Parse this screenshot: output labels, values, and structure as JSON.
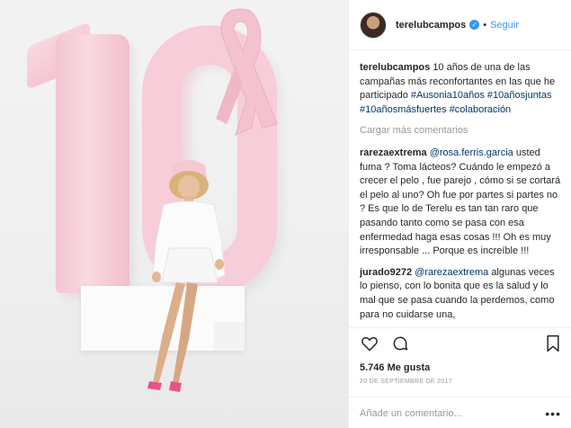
{
  "header": {
    "username": "terelubcampos",
    "verified_icon": "verified-badge-icon",
    "separator": "•",
    "follow_label": "Seguir"
  },
  "caption": {
    "username": "terelubcampos",
    "text": "10 años de una de las campañas más reconfortantes en las que he participado",
    "hashtags": [
      "#Ausonia10años",
      "#10añosjuntas",
      "#10añosmásfuertes",
      "#colaboración"
    ]
  },
  "load_more": "Cargar más comentarios",
  "comments": [
    {
      "username": "rarezaextrema",
      "mention": "@rosa.ferris.garcia",
      "text": "usted fuma ? Toma lácteos? Cuándo le empezó a crecer el pelo , fue parejo , cómo si se cortará el pelo al uno? Oh fue por partes si partes no ? Es que lo de Terelu es tan tan raro que pasando tanto como se pasa con esa enfermedad haga esas cosas !!! Oh es muy irresponsable ... Porque es increíble !!!"
    },
    {
      "username": "jurado9272",
      "mention": "@rarezaextrema",
      "text": "algunas veces lo pienso, con lo bonita que es la salud y lo mal que se pasa cuando la perdemos, como para no cuidarse una,"
    }
  ],
  "actions": {
    "like_icon": "heart-icon",
    "comment_icon": "comment-icon",
    "save_icon": "bookmark-icon"
  },
  "likes": "5.746 Me gusta",
  "date": "20 DE SEPTIEMBRE DE 2017",
  "add_comment": {
    "placeholder": "Añade un comentario...",
    "more_icon": "ellipsis-icon",
    "more_glyph": "•••"
  },
  "photo": {
    "numeral": "10",
    "colors": {
      "pink": "#f6cdd8",
      "ribbon": "#f4c2cf",
      "shoes": "#e8528a"
    }
  }
}
